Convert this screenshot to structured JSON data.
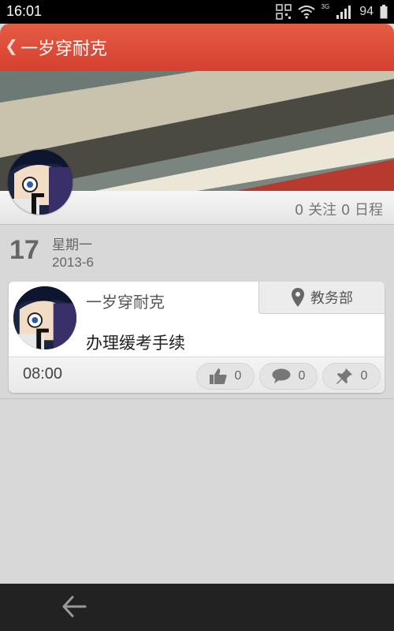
{
  "status_bar": {
    "time": "16:01",
    "network_label": "3G",
    "battery": "94",
    "icons": [
      "qr-scan-icon",
      "wifi-icon",
      "signal-icon",
      "battery-icon"
    ]
  },
  "header": {
    "back_icon": "chevron-left-icon",
    "title": "一岁穿耐克"
  },
  "profile": {
    "stats": "0 关注   0 日程"
  },
  "date": {
    "day": "17",
    "weekday": "星期一",
    "year_month": "2013-6"
  },
  "post": {
    "user": "一岁穿耐克",
    "department": "教务部",
    "content": "办理缓考手续",
    "time": "08:00",
    "likes": "0",
    "comments": "0",
    "pins": "0"
  },
  "colors": {
    "header_red": "#d64030",
    "background": "#d8d8d8",
    "nav_bar": "#222222"
  }
}
